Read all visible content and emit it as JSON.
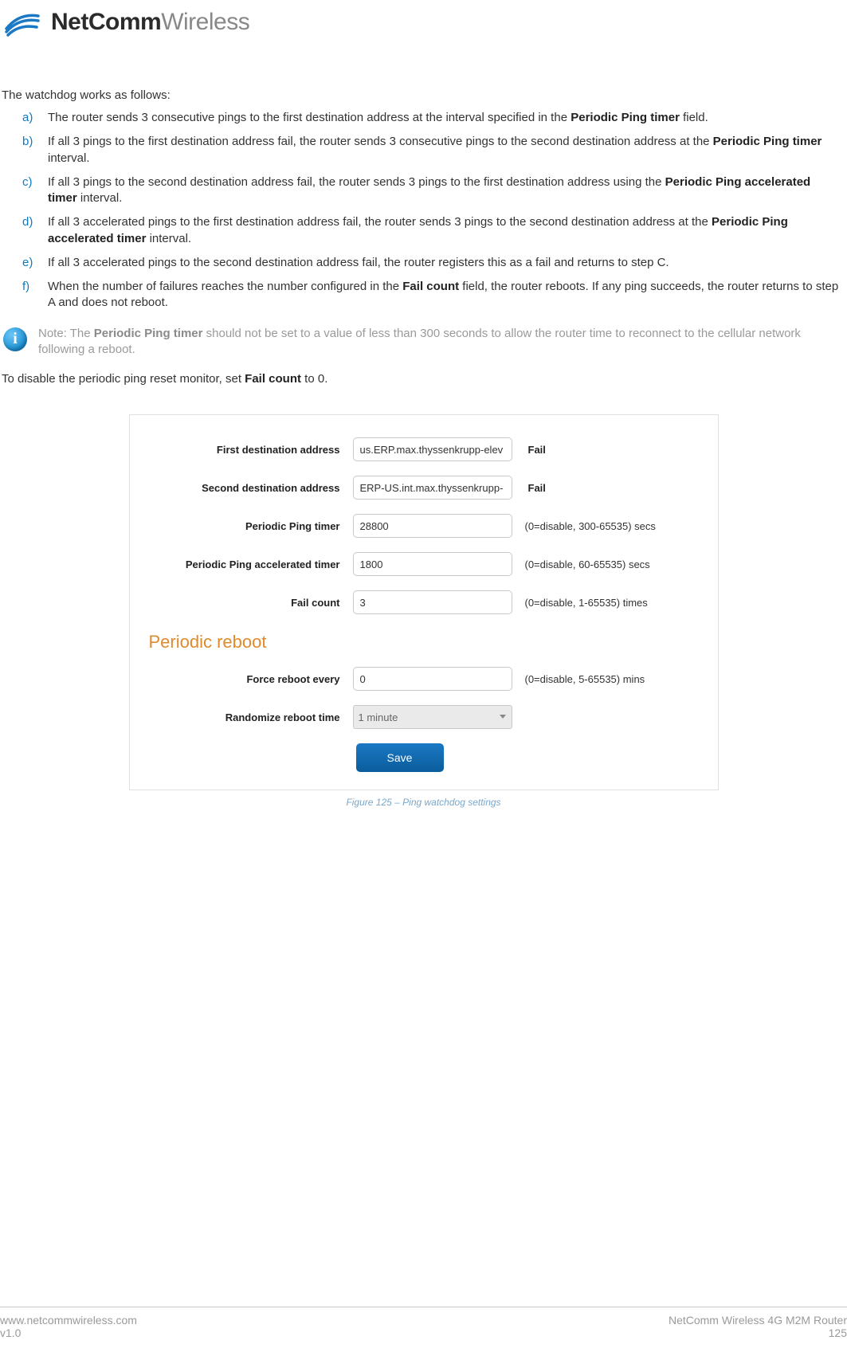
{
  "brand": {
    "bold": "NetComm",
    "light": "Wireless"
  },
  "intro": "The watchdog works as follows:",
  "list": [
    {
      "marker": "a)",
      "pre": "The router sends 3 consecutive pings to the first destination address at the interval specified in the ",
      "bold": "Periodic Ping timer",
      "post": " field."
    },
    {
      "marker": "b)",
      "pre": "If all 3 pings to the first destination address fail, the router sends 3 consecutive pings to the second destination address at the ",
      "bold": "Periodic Ping timer",
      "post": " interval."
    },
    {
      "marker": "c)",
      "pre": "If all 3 pings to the second destination address fail, the router sends 3 pings to the first destination address using the ",
      "bold": "Periodic Ping accelerated timer",
      "post": " interval."
    },
    {
      "marker": "d)",
      "pre": "If all 3 accelerated pings to the first destination address fail, the router sends 3 pings to the second destination address at the ",
      "bold": "Periodic Ping accelerated timer",
      "post": " interval."
    },
    {
      "marker": "e)",
      "pre": "If all 3 accelerated pings to the second destination address fail, the router registers this as a fail and returns to step C.",
      "bold": "",
      "post": ""
    },
    {
      "marker": "f)",
      "pre": "When the number of failures reaches the number configured in the ",
      "bold": "Fail count",
      "post": " field, the router reboots. If any ping succeeds, the router returns to step A and does not reboot."
    }
  ],
  "note": {
    "pre": "Note: The ",
    "bold": "Periodic Ping timer",
    "post": " should not be set to a value of less than 300 seconds to allow the router time to reconnect to the cellular network following a reboot."
  },
  "disable": {
    "pre": "To disable the periodic ping reset monitor, set ",
    "bold": "Fail count",
    "post": " to 0."
  },
  "form": {
    "first_dest": {
      "label": "First destination address",
      "value": "us.ERP.max.thyssenkrupp-elev",
      "status": "Fail"
    },
    "second_dest": {
      "label": "Second destination address",
      "value": "ERP-US.int.max.thyssenkrupp-",
      "status": "Fail"
    },
    "ping_timer": {
      "label": "Periodic Ping timer",
      "value": "28800",
      "hint": "(0=disable, 300-65535) secs"
    },
    "accel_timer": {
      "label": "Periodic Ping accelerated timer",
      "value": "1800",
      "hint": "(0=disable, 60-65535) secs"
    },
    "fail_count": {
      "label": "Fail count",
      "value": "3",
      "hint": "(0=disable, 1-65535) times"
    },
    "section_title": "Periodic reboot",
    "force_reboot": {
      "label": "Force reboot every",
      "value": "0",
      "hint": "(0=disable, 5-65535) mins"
    },
    "randomize": {
      "label": "Randomize reboot time",
      "value": "1 minute"
    },
    "save": "Save"
  },
  "figure_caption": "Figure 125 – Ping watchdog settings",
  "footer": {
    "url": "www.netcommwireless.com",
    "version": "v1.0",
    "product": "NetComm Wireless 4G M2M Router",
    "page": "125"
  }
}
